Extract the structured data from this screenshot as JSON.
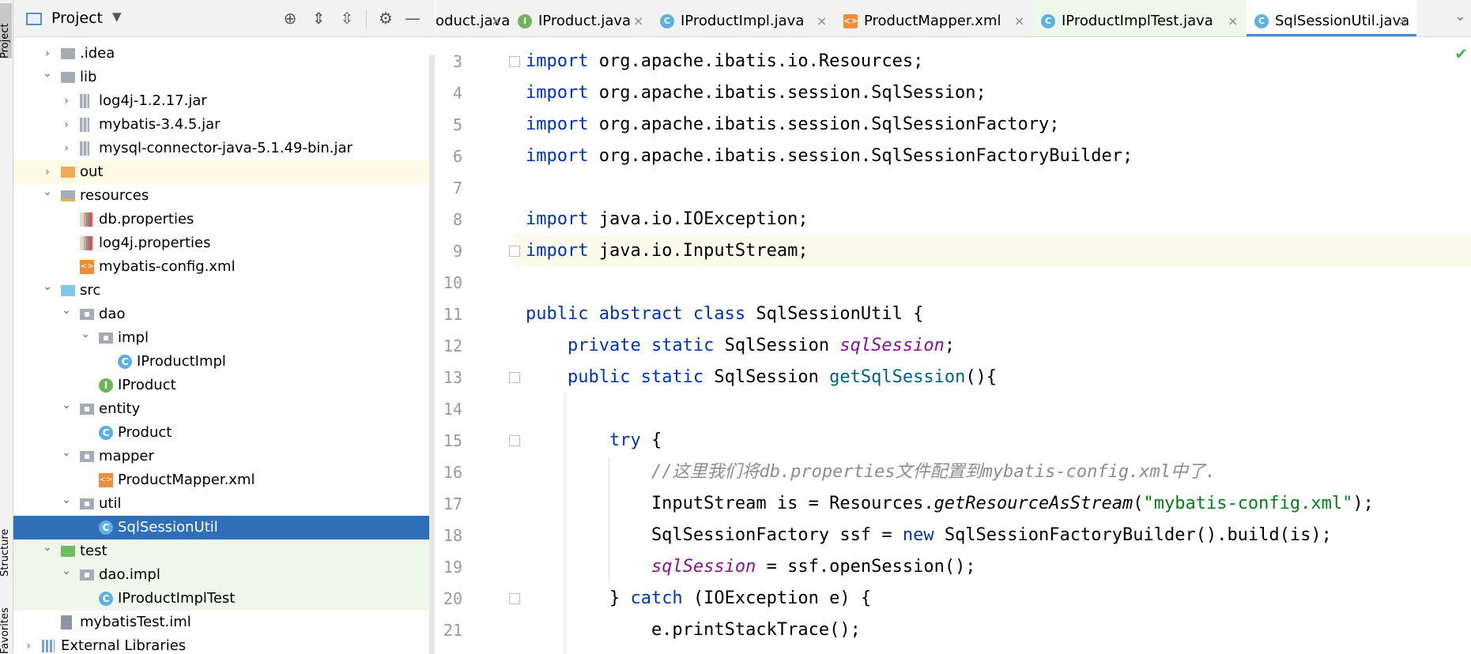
{
  "left_strip": {
    "project_label": "Project",
    "structure_label": "Structure",
    "favorites_label": "Favorites"
  },
  "project_panel": {
    "title": "Project",
    "tree": [
      {
        "label": ".idea",
        "kind": "folder-gray",
        "depth": 1,
        "expanded": false
      },
      {
        "label": "lib",
        "kind": "folder-gray",
        "depth": 1,
        "expanded": true
      },
      {
        "label": "log4j-1.2.17.jar",
        "kind": "jar",
        "depth": 2,
        "expanded": false
      },
      {
        "label": "mybatis-3.4.5.jar",
        "kind": "jar",
        "depth": 2,
        "expanded": false
      },
      {
        "label": "mysql-connector-java-5.1.49-bin.jar",
        "kind": "jar",
        "depth": 2,
        "expanded": false
      },
      {
        "label": "out",
        "kind": "folder-orange",
        "depth": 1,
        "expanded": false,
        "highlight": "yellow"
      },
      {
        "label": "resources",
        "kind": "folder-res",
        "depth": 1,
        "expanded": true
      },
      {
        "label": "db.properties",
        "kind": "props",
        "depth": 2
      },
      {
        "label": "log4j.properties",
        "kind": "props",
        "depth": 2
      },
      {
        "label": "mybatis-config.xml",
        "kind": "xml",
        "depth": 2
      },
      {
        "label": "src",
        "kind": "folder-blue",
        "depth": 1,
        "expanded": true
      },
      {
        "label": "dao",
        "kind": "pkg",
        "depth": 2,
        "expanded": true
      },
      {
        "label": "impl",
        "kind": "pkg",
        "depth": 3,
        "expanded": true
      },
      {
        "label": "IProductImpl",
        "kind": "cls",
        "depth": 4
      },
      {
        "label": "IProduct",
        "kind": "intf",
        "depth": 3
      },
      {
        "label": "entity",
        "kind": "pkg",
        "depth": 2,
        "expanded": true
      },
      {
        "label": "Product",
        "kind": "cls",
        "depth": 3
      },
      {
        "label": "mapper",
        "kind": "pkg",
        "depth": 2,
        "expanded": true
      },
      {
        "label": "ProductMapper.xml",
        "kind": "xml",
        "depth": 3
      },
      {
        "label": "util",
        "kind": "pkg",
        "depth": 2,
        "expanded": true
      },
      {
        "label": "SqlSessionUtil",
        "kind": "cls",
        "depth": 3,
        "highlight": "selected"
      },
      {
        "label": "test",
        "kind": "folder-green",
        "depth": 1,
        "expanded": true,
        "highlight": "green"
      },
      {
        "label": "dao.impl",
        "kind": "pkg",
        "depth": 2,
        "expanded": true,
        "highlight": "green"
      },
      {
        "label": "IProductImplTest",
        "kind": "cls",
        "depth": 3,
        "highlight": "green"
      },
      {
        "label": "mybatisTest.iml",
        "kind": "iml",
        "depth": 1
      },
      {
        "label": "External Libraries",
        "kind": "extlib",
        "depth": 0,
        "expanded": false
      }
    ]
  },
  "editor": {
    "tabs": [
      {
        "label": "oduct.java",
        "icon": "cls",
        "close": "×"
      },
      {
        "label": "IProduct.java",
        "icon": "intf",
        "close": "×"
      },
      {
        "label": "IProductImpl.java",
        "icon": "cls",
        "close": "×"
      },
      {
        "label": "ProductMapper.xml",
        "icon": "xml",
        "close": "×"
      },
      {
        "label": "IProductImplTest.java",
        "icon": "cls",
        "close": "×",
        "test": true
      },
      {
        "label": "SqlSessionUtil.java",
        "icon": "cls",
        "close": "×",
        "active": true
      }
    ],
    "tab_menu": "⌄",
    "lines": [
      {
        "n": "3",
        "fold": true,
        "tokens": [
          [
            "kw",
            "import"
          ],
          [
            "",
            "org.apache.ibatis.io.Resources;"
          ]
        ]
      },
      {
        "n": "4",
        "tokens": [
          [
            "kw",
            "import"
          ],
          [
            "",
            "org.apache.ibatis.session.SqlSession;"
          ]
        ]
      },
      {
        "n": "5",
        "tokens": [
          [
            "kw",
            "import"
          ],
          [
            "",
            "org.apache.ibatis.session.SqlSessionFactory;"
          ]
        ]
      },
      {
        "n": "6",
        "tokens": [
          [
            "kw",
            "import"
          ],
          [
            "",
            "org.apache.ibatis.session.SqlSessionFactoryBuilder;"
          ]
        ]
      },
      {
        "n": "7",
        "tokens": []
      },
      {
        "n": "8",
        "tokens": [
          [
            "kw",
            "import"
          ],
          [
            "",
            "java.io.IOException;"
          ]
        ]
      },
      {
        "n": "9",
        "fold": true,
        "current": true,
        "tokens": [
          [
            "kw",
            "import"
          ],
          [
            "",
            "java.io.InputStream;"
          ]
        ]
      },
      {
        "n": "10",
        "tokens": []
      },
      {
        "n": "11",
        "tokens": [
          [
            "kw",
            "public abstract class"
          ],
          [
            "",
            " SqlSessionUtil {"
          ]
        ]
      },
      {
        "n": "12",
        "tokens": [
          [
            "",
            "    "
          ],
          [
            "kw",
            "private static"
          ],
          [
            "",
            " SqlSession "
          ],
          [
            "fld",
            "sqlSession"
          ],
          [
            "",
            ";"
          ]
        ]
      },
      {
        "n": "13",
        "fold": true,
        "tokens": [
          [
            "",
            "    "
          ],
          [
            "kw",
            "public static"
          ],
          [
            "",
            " SqlSession "
          ],
          [
            "mth",
            "getSqlSession"
          ],
          [
            "",
            "(){"
          ]
        ]
      },
      {
        "n": "14",
        "tokens": []
      },
      {
        "n": "15",
        "fold": true,
        "tokens": [
          [
            "",
            "        "
          ],
          [
            "kw",
            "try"
          ],
          [
            "",
            " {"
          ]
        ]
      },
      {
        "n": "16",
        "tokens": [
          [
            "",
            "            "
          ],
          [
            "cmt",
            "//这里我们将db.properties文件配置到mybatis-config.xml中了."
          ]
        ]
      },
      {
        "n": "17",
        "tokens": [
          [
            "",
            "            InputStream is = Resources."
          ],
          [
            "itm",
            "getResourceAsStream"
          ],
          [
            "",
            "("
          ],
          [
            "str",
            "\"mybatis-config.xml\""
          ],
          [
            "",
            ");"
          ]
        ]
      },
      {
        "n": "18",
        "tokens": [
          [
            "",
            "            SqlSessionFactory ssf = "
          ],
          [
            "kw",
            "new"
          ],
          [
            "",
            " SqlSessionFactoryBuilder().build(is);"
          ]
        ]
      },
      {
        "n": "19",
        "tokens": [
          [
            "",
            "            "
          ],
          [
            "fld",
            "sqlSession"
          ],
          [
            "",
            " = ssf.openSession();"
          ]
        ]
      },
      {
        "n": "20",
        "fold": true,
        "tokens": [
          [
            "",
            "        } "
          ],
          [
            "kw",
            "catch"
          ],
          [
            "",
            " (IOException e) {"
          ]
        ]
      },
      {
        "n": "21",
        "tokens": [
          [
            "",
            "            e.printStackTrace();"
          ]
        ]
      }
    ]
  },
  "colors": {
    "keyword": "#0033b3",
    "field": "#871094",
    "method": "#00627a",
    "string": "#067d17",
    "comment": "#8c8c8c",
    "selection": "#2f6fb7"
  }
}
